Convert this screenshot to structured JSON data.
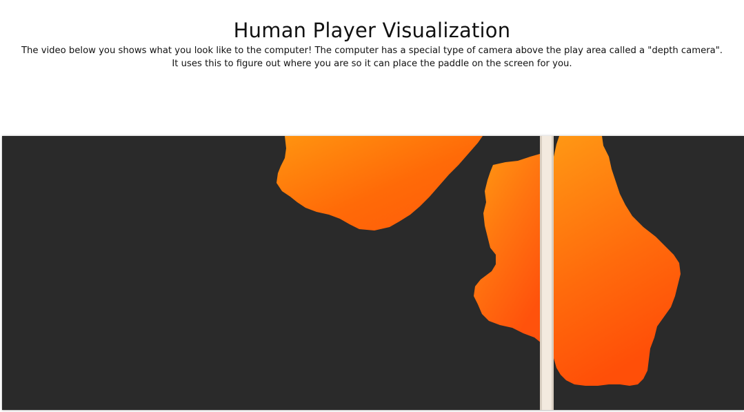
{
  "header": {
    "title": "Human Player Visualization",
    "description_line1": "The video below you shows what you look like to the computer! The computer has a special type of camera above the play area called a \"depth camera\".",
    "description_line2": "It uses this to figure out where you are so it can place the paddle on the screen for you."
  },
  "video": {
    "background_color": "#2a2a2a",
    "blob_color_light": "#ff9a10",
    "blob_color_dark": "#ff5a0a",
    "divider_color": "#f3eadf"
  }
}
